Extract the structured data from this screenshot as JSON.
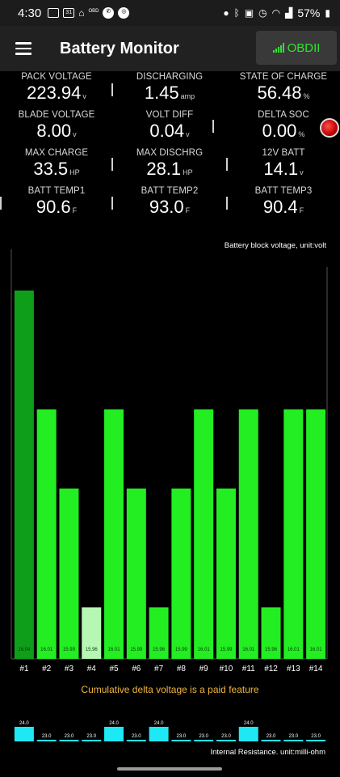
{
  "status_bar": {
    "time": "4:30",
    "battery_percent": "57%",
    "left_icons": [
      "message-icon",
      "calendar-icon",
      "google-home-icon",
      "obd-icon",
      "phone-icon",
      "fingerprint-icon"
    ],
    "calendar_day": "31",
    "obd_text": "OBD",
    "right_icons": [
      "location-icon",
      "bluetooth-icon",
      "nfc-icon",
      "alarm-icon",
      "wifi-icon",
      "signal-icon",
      "battery-icon"
    ]
  },
  "app_bar": {
    "title": "Battery Monitor",
    "obd_button_label": "OBDII",
    "accent_color": "#33e033"
  },
  "metrics": [
    {
      "label": "PACK VOLTAGE",
      "value": "223.94",
      "unit": "v"
    },
    {
      "label": "DISCHARGING",
      "value": "1.45",
      "unit": "amp"
    },
    {
      "label": "STATE OF CHARGE",
      "value": "56.48",
      "unit": "%"
    },
    {
      "label": "BLADE VOLTAGE",
      "value": "8.00",
      "unit": "v"
    },
    {
      "label": "VOLT DIFF",
      "value": "0.04",
      "unit": "v"
    },
    {
      "label": "DELTA SOC",
      "value": "0.00",
      "unit": "%"
    },
    {
      "label": "MAX CHARGE",
      "value": "33.5",
      "unit": "HP"
    },
    {
      "label": "MAX DISCHRG",
      "value": "28.1",
      "unit": "HP"
    },
    {
      "label": "12V BATT",
      "value": "14.1",
      "unit": "v"
    },
    {
      "label": "BATT TEMP1",
      "value": "90.6",
      "unit": "F"
    },
    {
      "label": "BATT TEMP2",
      "value": "93.0",
      "unit": "F"
    },
    {
      "label": "BATT TEMP3",
      "value": "90.4",
      "unit": "F"
    }
  ],
  "chart_title": "Battery block voltage, unit:volt",
  "chart_data": {
    "type": "bar",
    "categories": [
      "#1",
      "#2",
      "#3",
      "#4",
      "#5",
      "#6",
      "#7",
      "#8",
      "#9",
      "#10",
      "#11",
      "#12",
      "#13",
      "#14"
    ],
    "values": [
      16.04,
      16.01,
      15.99,
      15.96,
      16.01,
      15.99,
      15.96,
      15.99,
      16.01,
      15.99,
      16.01,
      15.96,
      16.01,
      16.01
    ],
    "value_labels": [
      "16.04",
      "16.01",
      "15.99",
      "15.96",
      "16.01",
      "15.99",
      "15.96",
      "15.99",
      "16.01",
      "15.99",
      "16.01",
      "15.96",
      "16.01",
      "16.01"
    ],
    "bar_colors": [
      "#0e9e1a",
      "#22ee22",
      "#22ee22",
      "#b6f7b3",
      "#22ee22",
      "#22ee22",
      "#22ee22",
      "#22ee22",
      "#22ee22",
      "#22ee22",
      "#22ee22",
      "#22ee22",
      "#22ee22",
      "#22ee22"
    ],
    "ylim": [
      15.947,
      16.05
    ],
    "grid": false
  },
  "paid_note": "Cumulative delta voltage is a paid feature",
  "resistance": {
    "label": "Internal Resistance. unit:milli-ohm",
    "values": [
      24.0,
      23.0,
      23.0,
      23.0,
      24.0,
      23.0,
      24.0,
      23.0,
      23.0,
      23.0,
      24.0,
      23.0,
      23.0,
      23.0
    ],
    "value_labels": [
      "24.0",
      "23.0",
      "23.0",
      "23.0",
      "24.0",
      "23.0",
      "24.0",
      "23.0",
      "23.0",
      "23.0",
      "24.0",
      "23.0",
      "23.0",
      "23.0"
    ],
    "high_color": "#1fe8f5",
    "low_color": "#1fe8f5"
  }
}
